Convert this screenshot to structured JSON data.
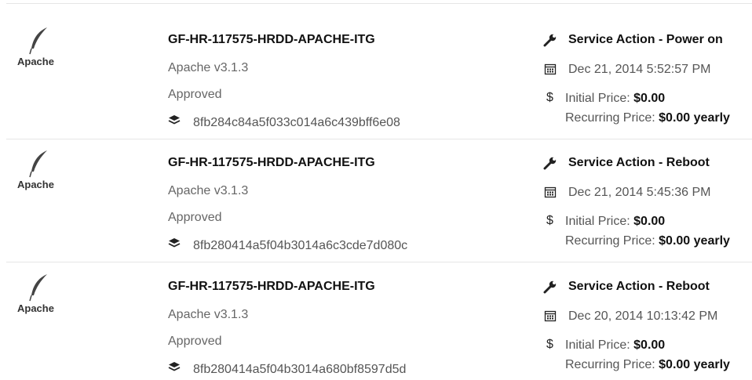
{
  "rows": [
    {
      "logo_text": "Apache",
      "title": "GF-HR-117575-HRDD-APACHE-ITG",
      "version": "Apache v3.1.3",
      "status": "Approved",
      "hash": "8fb284c84a5f033c014a6c439bff6e08",
      "action": "Service Action - Power on",
      "date": "Dec 21, 2014 5:52:57 PM",
      "initial_label": "Initial Price:",
      "initial_value": "$0.00",
      "recurring_label": "Recurring Price:",
      "recurring_value": "$0.00 yearly"
    },
    {
      "logo_text": "Apache",
      "title": "GF-HR-117575-HRDD-APACHE-ITG",
      "version": "Apache v3.1.3",
      "status": "Approved",
      "hash": "8fb280414a5f04b3014a6c3cde7d080c",
      "action": "Service Action - Reboot",
      "date": "Dec 21, 2014 5:45:36 PM",
      "initial_label": "Initial Price:",
      "initial_value": "$0.00",
      "recurring_label": "Recurring Price:",
      "recurring_value": "$0.00 yearly"
    },
    {
      "logo_text": "Apache",
      "title": "GF-HR-117575-HRDD-APACHE-ITG",
      "version": "Apache v3.1.3",
      "status": "Approved",
      "hash": "8fb280414a5f04b3014a680bf8597d5d",
      "action": "Service Action - Reboot",
      "date": "Dec 20, 2014 10:13:42 PM",
      "initial_label": "Initial Price:",
      "initial_value": "$0.00",
      "recurring_label": "Recurring Price:",
      "recurring_value": "$0.00 yearly"
    }
  ],
  "icons": {
    "logo": "apache-feather-icon",
    "hash": "layers-icon",
    "action": "wrench-icon",
    "date": "calendar-icon",
    "price": "dollar-icon"
  },
  "dollar_glyph": "$"
}
